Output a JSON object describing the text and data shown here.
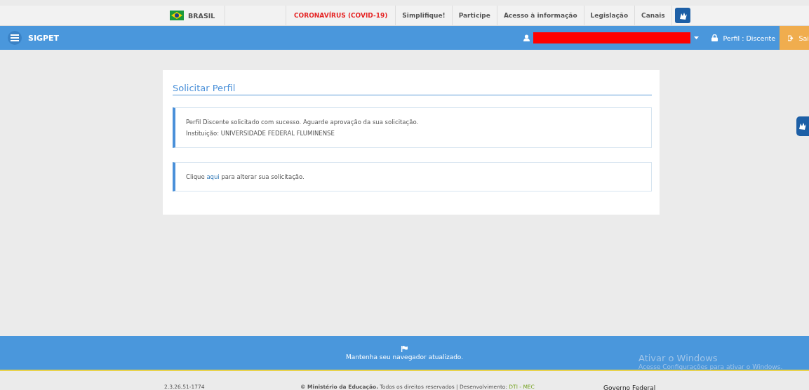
{
  "gov_bar": {
    "country": "BRASIL",
    "links": [
      {
        "label": "CORONAVÍRUS (COVID-19)",
        "kind": "alert"
      },
      {
        "label": "Simplifique!",
        "kind": "normal"
      },
      {
        "label": "Participe",
        "kind": "normal"
      },
      {
        "label": "Acesso à informação",
        "kind": "normal"
      },
      {
        "label": "Legislação",
        "kind": "normal"
      },
      {
        "label": "Canais",
        "kind": "normal"
      }
    ]
  },
  "header": {
    "title": "SIGPET",
    "user_redacted": true,
    "profile": "Perfil : Discente",
    "logout": "Sai"
  },
  "card": {
    "title": "Solicitar Perfil",
    "alerts": [
      {
        "lines": [
          "Perfil Discente solicitado com sucesso. Aguarde aprovação da sua solicitação.",
          "Instituição: UNIVERSIDADE FEDERAL FLUMINENSE"
        ]
      },
      {
        "before": "Clique ",
        "link": "aqui",
        "after": " para alterar sua solicitação."
      }
    ]
  },
  "footer": {
    "message": "Mantenha seu navegador atualizado.",
    "version": "2.3.26.51-1774",
    "copyright": "**© Ministério da Educação.** Todos os direitos reservados | Desenvolvimento: ",
    "dev_link": "DTI - MEC",
    "brand": "Governo Federal"
  },
  "os_overlay": {
    "title": "Ativar o Windows",
    "subtitle": "Acesse Configurações para ativar o Windows."
  }
}
